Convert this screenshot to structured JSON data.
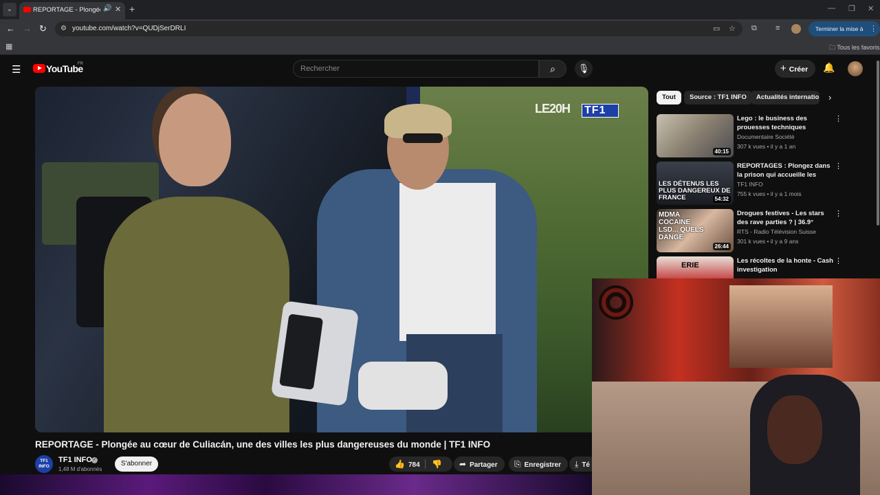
{
  "browser": {
    "tab_title": "REPORTAGE - Plongée au cœur de Culiacán",
    "url": "youtube.com/watch?v=QUDjSerDRLI",
    "update_button": "Terminer la mise à jour",
    "bookmarks_label": "Tous les favoris"
  },
  "youtube": {
    "logo": "YouTube",
    "country": "FR",
    "search_placeholder": "Rechercher",
    "create_label": "Créer"
  },
  "video": {
    "title": "REPORTAGE - Plongée au cœur de Culiacán, une des villes les plus dangereuses du monde | TF1 INFO",
    "watermark": "LE20H",
    "watermark_brand": "TF1",
    "channel": {
      "name": "TF1 INFO",
      "logo_text": "TF1 INFO",
      "subscribers": "1,48 M d'abonnés",
      "subscribe_label": "S'abonner"
    },
    "likes": "784",
    "share_label": "Partager",
    "save_label": "Enregistrer",
    "download_label": "Té"
  },
  "chips": [
    {
      "label": "Tout",
      "active": true
    },
    {
      "label": "Source : TF1 INFO",
      "active": false
    },
    {
      "label": "Actualités internatio",
      "active": false
    }
  ],
  "recommendations": [
    {
      "title": "Lego : le business des prouesses techniques",
      "channel": "Documentaire Société",
      "meta": "307 k vues • il y a 1 an",
      "duration": "40:15",
      "thumb_text": ""
    },
    {
      "title": "REPORTAGES : Plongez dans la prison qui accueille les détenu...",
      "channel": "TF1 INFO",
      "meta": "755 k vues • il y a 1 mois",
      "duration": "54:32",
      "thumb_text": "LES DÉTENUS LES PLUS DANGEREUX DE FRANCE"
    },
    {
      "title": "Drogues festives - Les stars des rave parties ? | 36.9°",
      "channel": "RTS - Radio Télévision Suisse",
      "meta": "301 k vues • il y a 9 ans",
      "duration": "26:44",
      "thumb_text": "MDMA COCAINE LSD... QUELS DANGE"
    },
    {
      "title": "Les récoltes de la honte - Cash investigation",
      "channel": "",
      "meta": "",
      "duration": "",
      "thumb_text": "ERIE"
    }
  ],
  "colors": {
    "youtube_red": "#ff0000",
    "tf1_blue": "#1d3fa8",
    "page_bg": "#0f0f0f"
  }
}
